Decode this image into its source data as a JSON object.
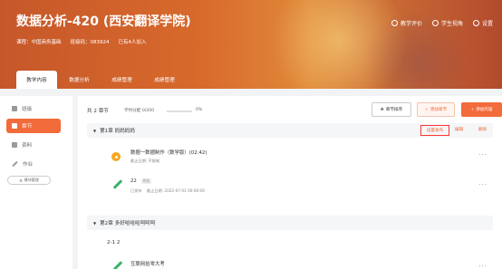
{
  "header": {
    "course_title": "数据分析-420 (西安翻译学院)",
    "meta_course": "课程：中国商务基础",
    "meta_class_code": "班级码：083924",
    "meta_joined": "已有4人加入",
    "actions": [
      "教学评价",
      "学生视角",
      "设置"
    ]
  },
  "tabs": [
    "教学内容",
    "数据分析",
    "成绩管理",
    "成绩管理"
  ],
  "sidebar": {
    "items": [
      "班级",
      "章节",
      "资料",
      "作业"
    ],
    "template_button": "模块管理"
  },
  "toolbar": {
    "chapter_count": "共 2 章节",
    "progress_label": "学时分配 0/200",
    "progress_percent": "0%",
    "progress_value": 0,
    "sort_label": "章节排序",
    "add_chapter_label": "添加章节",
    "add_task_label": "添加内容"
  },
  "chapters": [
    {
      "title": "第1章 妈妈妈妈",
      "set_publish": "设置发布",
      "edit": "编辑",
      "delete": "删除",
      "tasks": [
        {
          "type": "video",
          "name": "数据一数据制作（数学版）(02:42)",
          "sub": "截止日期: 不限制"
        },
        {
          "type": "homework",
          "name": "22",
          "tag": "作业",
          "sub_tag": "已发布",
          "sub": "截止日期: 2022-07-02 00:00:00"
        }
      ]
    },
    {
      "title": "第2章 多好哈哈哈呵呵呵",
      "subsection": "2-1 2",
      "tasks": [
        {
          "type": "homework",
          "name": "互联网拾零大考"
        }
      ]
    }
  ],
  "colors": {
    "accent": "#f26b3a",
    "danger_outline": "#ff3333",
    "video_icon": "#f5a623",
    "homework_icon": "#3bb26b"
  }
}
